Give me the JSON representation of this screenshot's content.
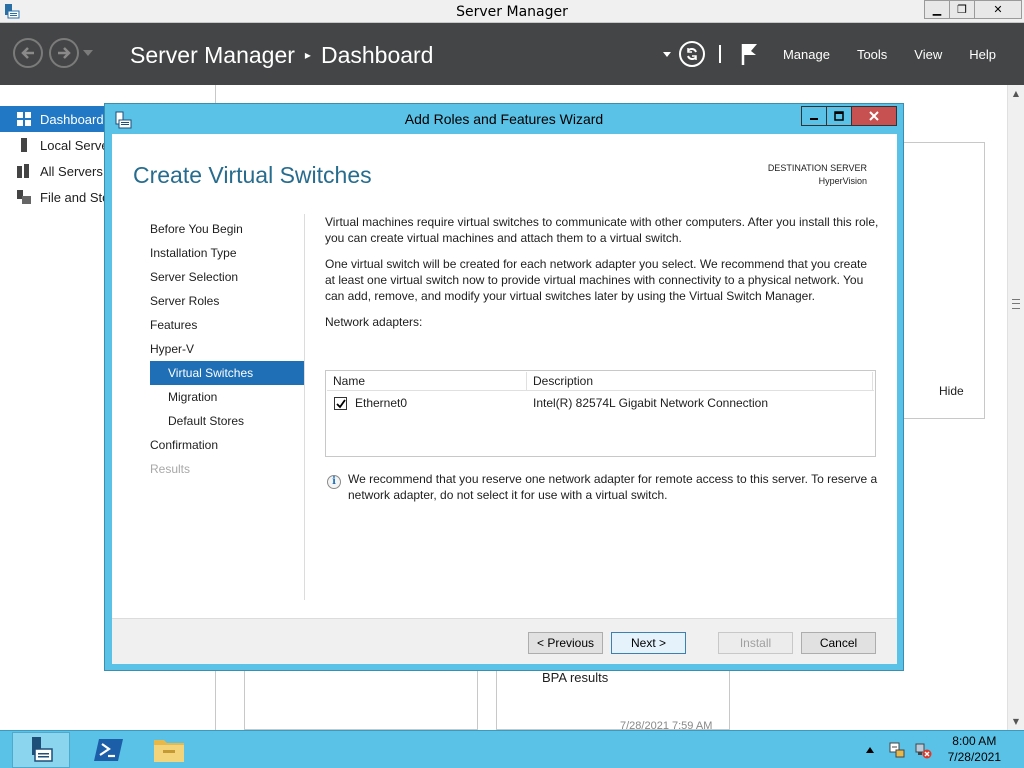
{
  "window": {
    "title": "Server Manager",
    "minimize": "▁",
    "restore": "❐",
    "close": "✕"
  },
  "header": {
    "app": "Server Manager",
    "separator": "▸",
    "page": "Dashboard",
    "menu": [
      "Manage",
      "Tools",
      "View",
      "Help"
    ]
  },
  "sidebar": {
    "items": [
      {
        "label": "Dashboard",
        "icon": "dashboard-icon",
        "active": true
      },
      {
        "label": "Local Server",
        "icon": "server-icon"
      },
      {
        "label": "All Servers",
        "icon": "servers-icon"
      },
      {
        "label": "File and Storage Services",
        "icon": "storage-icon"
      }
    ]
  },
  "background": {
    "hide": "Hide",
    "bpa": "BPA results",
    "timestamp": "7/28/2021 7:59 AM"
  },
  "wizard": {
    "title": "Add Roles and Features Wizard",
    "page_title": "Create Virtual Switches",
    "dest_label": "DESTINATION SERVER",
    "dest_server": "HyperVision",
    "steps": [
      {
        "label": "Before You Begin",
        "state": "normal"
      },
      {
        "label": "Installation Type",
        "state": "normal"
      },
      {
        "label": "Server Selection",
        "state": "normal"
      },
      {
        "label": "Server Roles",
        "state": "normal"
      },
      {
        "label": "Features",
        "state": "normal"
      },
      {
        "label": "Hyper-V",
        "state": "normal"
      },
      {
        "label": "Virtual Switches",
        "state": "current"
      },
      {
        "label": "Migration",
        "state": "sub"
      },
      {
        "label": "Default Stores",
        "state": "sub"
      },
      {
        "label": "Confirmation",
        "state": "normal"
      },
      {
        "label": "Results",
        "state": "disabled"
      }
    ],
    "para1": "Virtual machines require virtual switches to communicate with other computers. After you install this role, you can create virtual machines and attach them to a virtual switch.",
    "para2": "One virtual switch will be created for each network adapter you select. We recommend that you create at least one virtual switch now to provide virtual machines with connectivity to a physical network. You can add, remove, and modify your virtual switches later by using the Virtual Switch Manager.",
    "adapters_label": "Network adapters:",
    "columns": {
      "name": "Name",
      "description": "Description"
    },
    "adapters": [
      {
        "name": "Ethernet0",
        "description": "Intel(R) 82574L Gigabit Network Connection",
        "checked": true
      }
    ],
    "note": "We recommend that you reserve one network adapter for remote access to this server. To reserve a network adapter, do not select it for use with a virtual switch.",
    "buttons": {
      "previous": "< Previous",
      "next": "Next >",
      "install": "Install",
      "cancel": "Cancel"
    }
  },
  "taskbar": {
    "time": "8:00 AM",
    "date": "7/28/2021"
  },
  "colors": {
    "accent": "#5ac2e6",
    "header_bg": "#444546",
    "selection": "#1f6fb6",
    "title_text": "#276c8e"
  }
}
